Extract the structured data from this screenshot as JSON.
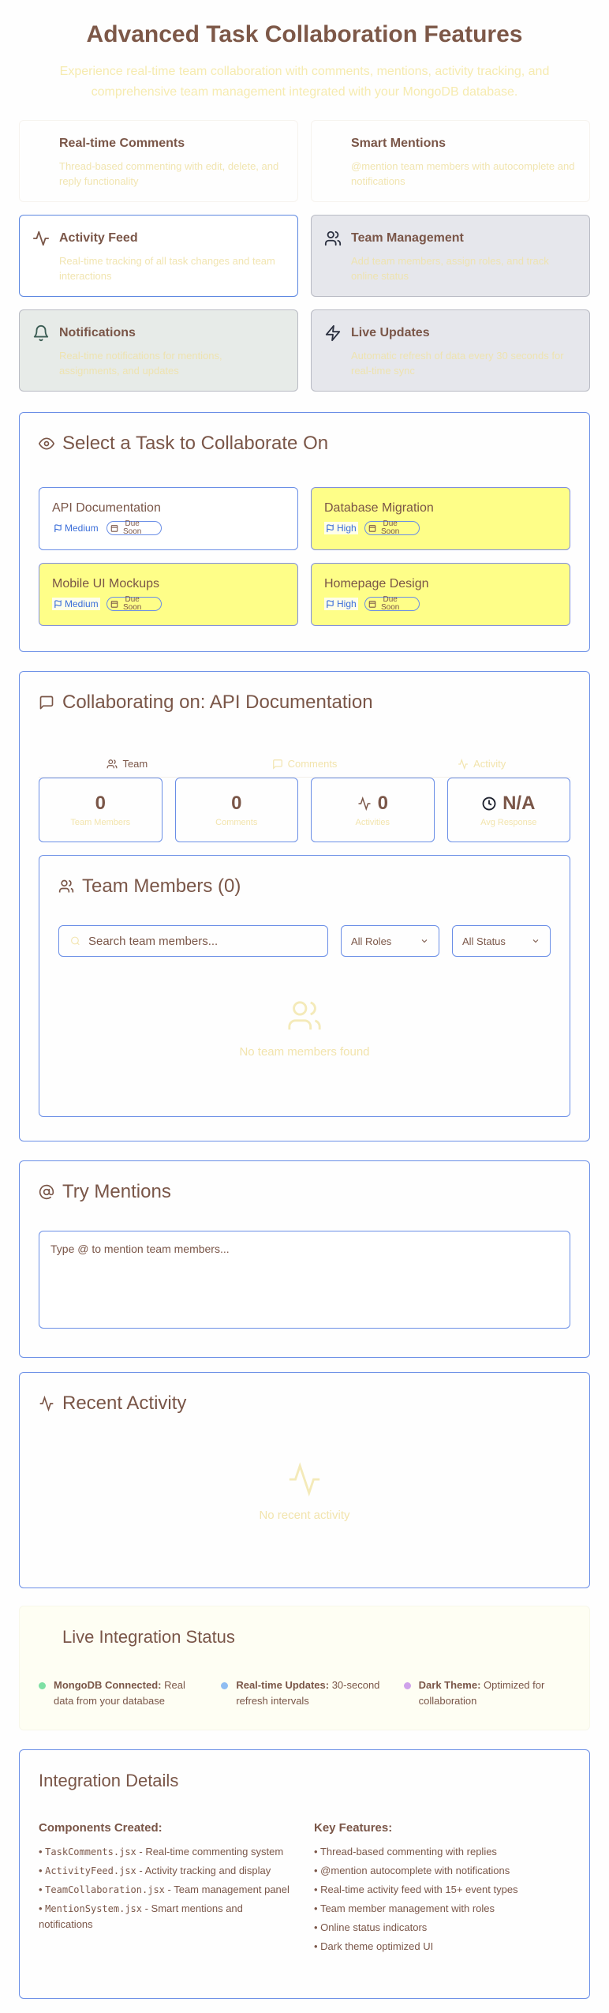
{
  "header": {
    "title": "Advanced Task Collaboration Features",
    "subtitle": "Experience real-time team collaboration with comments, mentions, activity tracking, and comprehensive team management integrated with your MongoDB database."
  },
  "features": [
    {
      "title": "Real-time Comments",
      "desc": "Thread-based commenting with edit, delete, and reply functionality",
      "icon": "message-icon"
    },
    {
      "title": "Smart Mentions",
      "desc": "@mention team members with autocomplete and notifications",
      "icon": "at-icon"
    },
    {
      "title": "Activity Feed",
      "desc": "Real-time tracking of all task changes and team interactions",
      "icon": "activity-icon"
    },
    {
      "title": "Team Management",
      "desc": "Add team members, assign roles, and track online status",
      "icon": "users-icon"
    },
    {
      "title": "Notifications",
      "desc": "Real-time notifications for mentions, assignments, and updates",
      "icon": "bell-icon"
    },
    {
      "title": "Live Updates",
      "desc": "Automatic refresh of data every 30 seconds for real-time sync",
      "icon": "zap-icon"
    }
  ],
  "select_task": {
    "title": "Select a Task to Collaborate On",
    "tasks": [
      {
        "name": "API Documentation",
        "priority": "Medium",
        "due": "Due Soon"
      },
      {
        "name": "Database Migration",
        "priority": "High",
        "due": "Due Soon"
      },
      {
        "name": "Mobile UI Mockups",
        "priority": "Medium",
        "due": "Due Soon"
      },
      {
        "name": "Homepage Design",
        "priority": "High",
        "due": "Due Soon"
      }
    ]
  },
  "collab": {
    "title": "Collaborating on: API Documentation",
    "tabs": [
      "Team",
      "Comments",
      "Activity"
    ],
    "stats": [
      {
        "value": "0",
        "label": "Team Members"
      },
      {
        "value": "0",
        "label": "Comments"
      },
      {
        "value": "0",
        "label": "Activities"
      },
      {
        "value": "N/A",
        "label": "Avg Response"
      }
    ],
    "members": {
      "title": "Team Members (0)",
      "search_placeholder": "Search team members...",
      "roles_select": "All Roles",
      "status_select": "All Status",
      "empty": "No team members found"
    }
  },
  "mentions": {
    "title": "Try Mentions",
    "placeholder": "Type @ to mention team members..."
  },
  "activity": {
    "title": "Recent Activity",
    "empty": "No recent activity"
  },
  "live": {
    "title": "Live Integration Status",
    "items": [
      {
        "strong": "MongoDB Connected:",
        "text": " Real data from your database",
        "color": "#7ee0a4"
      },
      {
        "strong": "Real-time Updates:",
        "text": " 30-second refresh intervals",
        "color": "#8fbdf2"
      },
      {
        "strong": "Dark Theme:",
        "text": " Optimized for collaboration",
        "color": "#cfa2ea"
      }
    ]
  },
  "details": {
    "title": "Integration Details",
    "components_heading": "Components Created:",
    "components": [
      {
        "file": "TaskComments.jsx",
        "desc": " - Real-time commenting system"
      },
      {
        "file": "ActivityFeed.jsx",
        "desc": " - Activity tracking and display"
      },
      {
        "file": "TeamCollaboration.jsx",
        "desc": " - Team management panel"
      },
      {
        "file": "MentionSystem.jsx",
        "desc": " - Smart mentions and notifications"
      }
    ],
    "features_heading": "Key Features:",
    "features": [
      "Thread-based commenting with replies",
      "@mention autocomplete with notifications",
      "Real-time activity feed with 15+ event types",
      "Team member management with roles",
      "Online status indicators",
      "Dark theme optimized UI"
    ]
  }
}
